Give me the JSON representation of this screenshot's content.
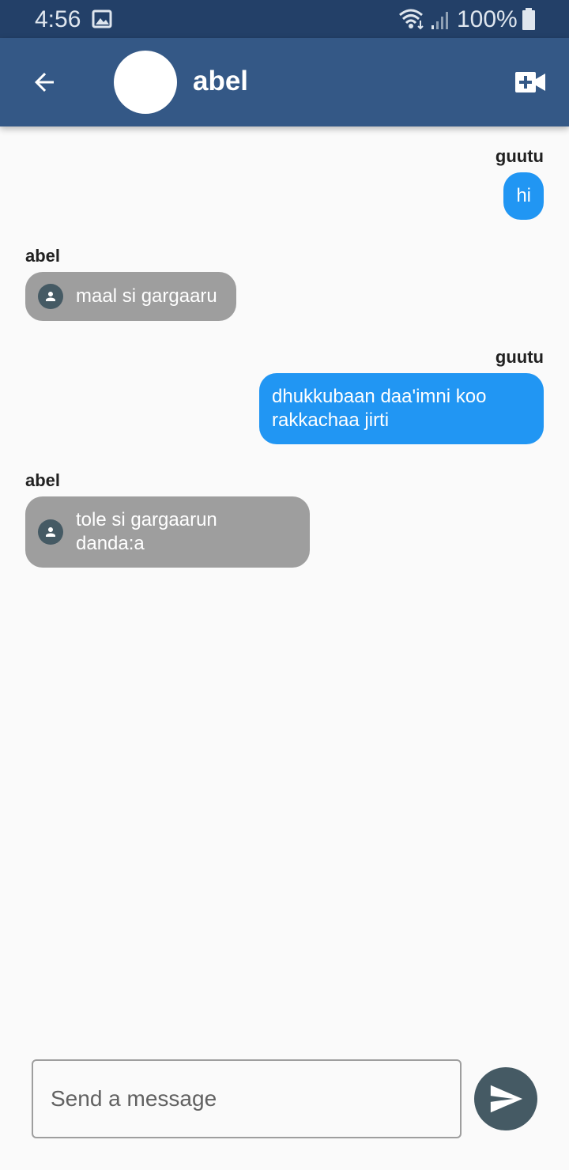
{
  "status_bar": {
    "time": "4:56",
    "battery": "100%",
    "icons": [
      "gallery-icon",
      "wifi-icon",
      "signal-icon",
      "battery-icon"
    ]
  },
  "app_bar": {
    "title": "abel",
    "back_icon": "arrow-back-icon",
    "action_icon": "video-call-icon"
  },
  "messages": [
    {
      "sender": "guutu",
      "text": "hi",
      "direction": "outgoing"
    },
    {
      "sender": "abel",
      "text": "maal si gargaaru",
      "direction": "incoming"
    },
    {
      "sender": "guutu",
      "text": "dhukkubaan daa'imni koo rakkachaa jirti",
      "direction": "outgoing"
    },
    {
      "sender": "abel",
      "text": "tole si gargaarun danda:a",
      "direction": "incoming"
    }
  ],
  "composer": {
    "placeholder": "Send a message",
    "send_icon": "send-icon"
  },
  "colors": {
    "status_bar": "#234068",
    "app_bar": "#345886",
    "outgoing_bubble": "#2196f3",
    "incoming_bubble": "#9e9e9e",
    "send_button": "#455a64"
  }
}
